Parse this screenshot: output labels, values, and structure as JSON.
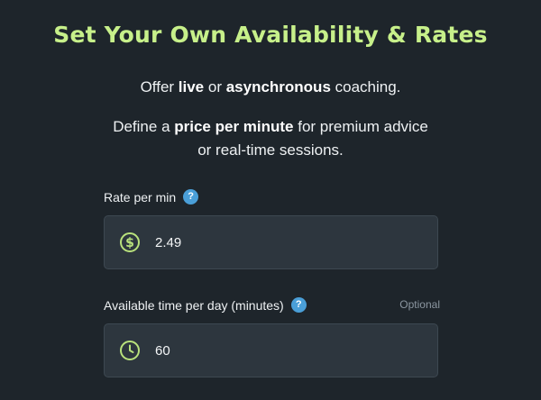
{
  "header": {
    "title": "Set Your Own Availability & Rates"
  },
  "intro": {
    "line1": {
      "prefix": "Offer ",
      "bold1": "live",
      "middle": " or ",
      "bold2": "asynchronous",
      "suffix": " coaching."
    },
    "line2": {
      "prefix": "Define a ",
      "bold": "price per minute",
      "suffix": " for premium advice"
    },
    "line3": "or real-time sessions."
  },
  "rate_field": {
    "label": "Rate per min",
    "help_glyph": "?",
    "icon": "dollar-circle-icon",
    "value": "2.49"
  },
  "time_field": {
    "label": "Available time per day (minutes)",
    "help_glyph": "?",
    "optional_label": "Optional",
    "icon": "clock-icon",
    "value": "60"
  },
  "colors": {
    "background": "#1e252b",
    "title": "#c7f08a",
    "accent_icon": "#b9e27c",
    "help_badge": "#4a9fd8",
    "input_bg": "#2d363e"
  }
}
